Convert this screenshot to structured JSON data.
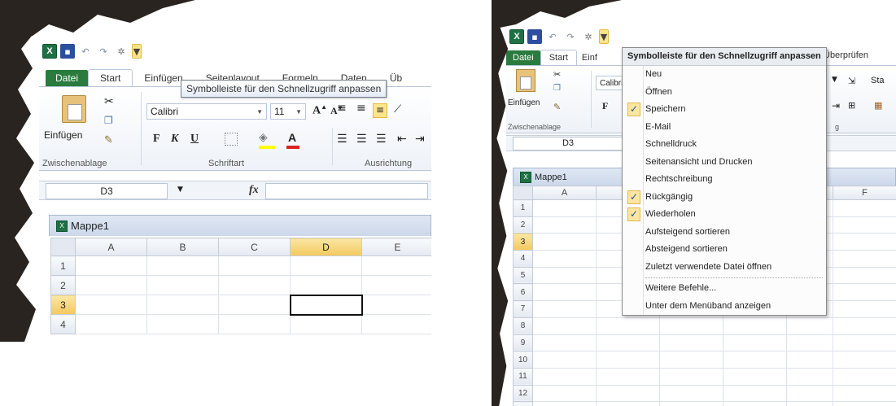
{
  "left": {
    "qat": {
      "dropdown_tooltip": "Symbolleiste für den Schnellzugriff anpassen"
    },
    "tabs": [
      "Datei",
      "Start",
      "Einfügen",
      "Seitenlayout",
      "Formeln",
      "Daten",
      "Üb"
    ],
    "ribbon": {
      "paste_label": "Einfügen",
      "clipboard_group": "Zwischenablage",
      "font_group": "Schriftart",
      "align_group": "Ausrichtung",
      "font_name": "Calibri",
      "font_size": "11",
      "bold": "F",
      "italic": "K",
      "underline": "U"
    },
    "name_box": "D3",
    "fx": "fx",
    "workbook_title": "Mappe1",
    "columns": [
      "A",
      "B",
      "C",
      "D",
      "E"
    ],
    "rows": [
      "1",
      "2",
      "3",
      "4"
    ]
  },
  "right": {
    "tabs": [
      "Datei",
      "Start",
      "Einf",
      "Überprüfen"
    ],
    "ribbon": {
      "paste_label": "Einfügen",
      "clipboard_group": "Zwischenablage",
      "font_name": "Calibri",
      "bold": "F",
      "align_group_fragment": "g",
      "style_fragment": "Sta"
    },
    "name_box": "D3",
    "workbook_title": "Mappe1",
    "columns": [
      "A",
      "F"
    ],
    "rows": [
      "1",
      "2",
      "3",
      "4",
      "5",
      "6",
      "7",
      "8",
      "9",
      "10",
      "11",
      "12",
      "13"
    ],
    "menu": {
      "header": "Symbolleiste für den Schnellzugriff anpassen",
      "items": [
        {
          "label": "Neu",
          "checked": false
        },
        {
          "label": "Öffnen",
          "checked": false
        },
        {
          "label": "Speichern",
          "checked": true
        },
        {
          "label": "E-Mail",
          "checked": false
        },
        {
          "label": "Schnelldruck",
          "checked": false
        },
        {
          "label": "Seitenansicht und Drucken",
          "checked": false
        },
        {
          "label": "Rechtschreibung",
          "checked": false
        },
        {
          "label": "Rückgängig",
          "checked": true
        },
        {
          "label": "Wiederholen",
          "checked": true
        },
        {
          "label": "Aufsteigend sortieren",
          "checked": false
        },
        {
          "label": "Absteigend sortieren",
          "checked": false
        },
        {
          "label": "Zuletzt verwendete Datei öffnen",
          "checked": false
        }
      ],
      "more_commands": "Weitere Befehle...",
      "show_below": "Unter dem Menüband anzeigen",
      "check_glyph": "✓"
    }
  },
  "colors": {
    "file_tab": "#2a7b3e",
    "excel_green": "#1e7145",
    "highlight": "#fde58b",
    "selected_header": "#f3c85f"
  }
}
